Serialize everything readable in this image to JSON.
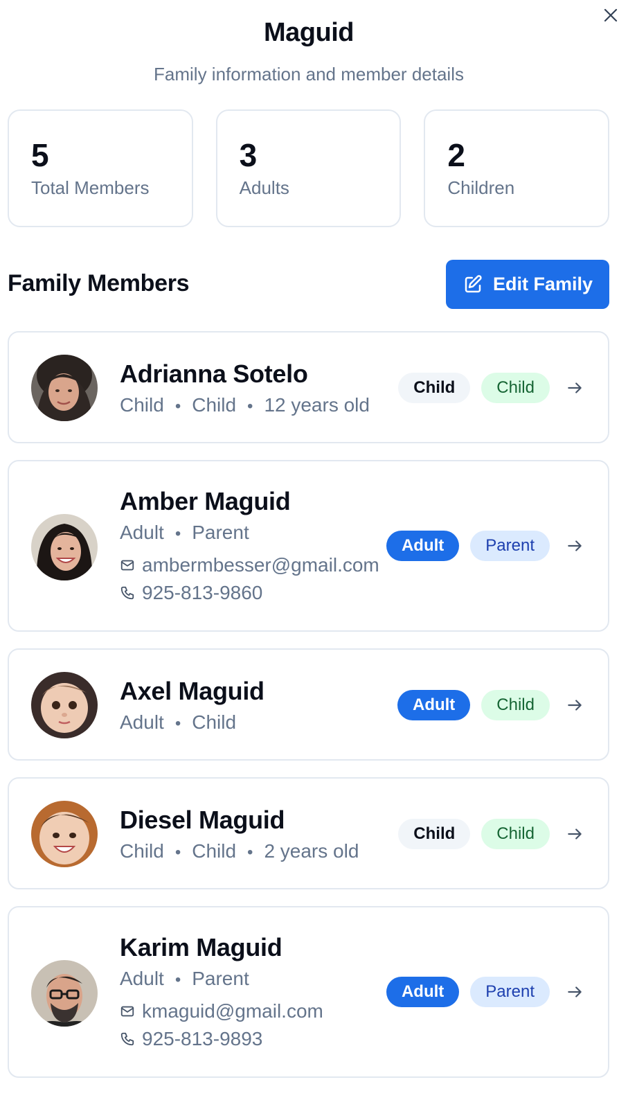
{
  "header": {
    "title": "Maguid",
    "subtitle": "Family information and member details",
    "close_icon": "x-icon"
  },
  "stats": [
    {
      "value": "5",
      "label": "Total Members"
    },
    {
      "value": "3",
      "label": "Adults"
    },
    {
      "value": "2",
      "label": "Children"
    }
  ],
  "section": {
    "title": "Family Members",
    "edit_button": "Edit Family",
    "edit_icon": "pencil-square-icon"
  },
  "members": [
    {
      "name": "Adrianna Sotelo",
      "type": "Child",
      "role": "Child",
      "age": "12 years old",
      "badges": [
        "Child",
        "Child"
      ]
    },
    {
      "name": "Amber Maguid",
      "type": "Adult",
      "role": "Parent",
      "email": "ambermbesser@gmail.com",
      "phone": "925-813-9860",
      "badges": [
        "Adult",
        "Parent"
      ]
    },
    {
      "name": "Axel Maguid",
      "type": "Adult",
      "role": "Child",
      "badges": [
        "Adult",
        "Child"
      ]
    },
    {
      "name": "Diesel Maguid",
      "type": "Child",
      "role": "Child",
      "age": "2 years old",
      "badges": [
        "Child",
        "Child"
      ]
    },
    {
      "name": "Karim Maguid",
      "type": "Adult",
      "role": "Parent",
      "email": "kmaguid@gmail.com",
      "phone": "925-813-9893",
      "badges": [
        "Adult",
        "Parent"
      ]
    }
  ],
  "colors": {
    "primary": "#1d6ee8",
    "muted_text": "#64748b",
    "border": "#e2e8f0",
    "green_badge_bg": "#dcfce7",
    "green_badge_text": "#166534",
    "blue_badge_bg": "#dbeafe",
    "blue_badge_text": "#1e40af",
    "gray_badge_bg": "#f1f5f9"
  },
  "icons": {
    "dot": "•",
    "arrow": "arrow-right-icon",
    "mail": "mail-icon",
    "phone": "phone-icon"
  }
}
